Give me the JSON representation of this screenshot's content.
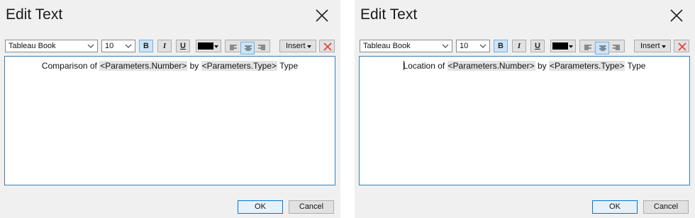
{
  "dialogs": [
    {
      "title": "Edit Text",
      "font_family": "Tableau Book",
      "font_size": "10",
      "bold_label": "B",
      "italic_label": "I",
      "underline_label": "U",
      "insert_label": "Insert",
      "text_prefix": "Comparison of ",
      "param1": "<Parameters.Number>",
      "mid": " by ",
      "param2": "<Parameters.Type>",
      "suffix": " Type",
      "ok_label": "OK",
      "cancel_label": "Cancel"
    },
    {
      "title": "Edit Text",
      "font_family": "Tableau Book",
      "font_size": "10",
      "bold_label": "B",
      "italic_label": "I",
      "underline_label": "U",
      "insert_label": "Insert",
      "text_prefix": "Location of ",
      "param1": "<Parameters.Number>",
      "mid": " by ",
      "param2": "<Parameters.Type>",
      "suffix": " Type",
      "ok_label": "OK",
      "cancel_label": "Cancel"
    }
  ],
  "icons": {
    "close": "close-icon",
    "dropdown": "chevron-down-icon",
    "align_left": "align-left-icon",
    "align_center": "align-center-icon",
    "align_right": "align-right-icon",
    "delete": "delete-x-icon"
  },
  "colors": {
    "text_color_swatch": "#000000",
    "delete_red": "#e0463c",
    "active_blue": "#cce4f7"
  }
}
